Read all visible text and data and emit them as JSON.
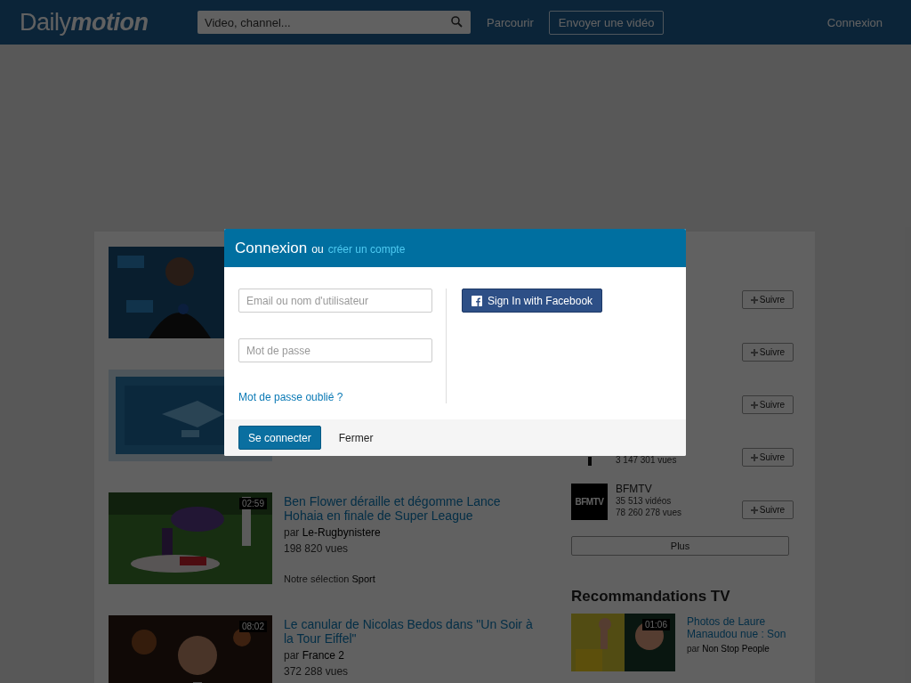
{
  "header": {
    "logo": "Daily**motion**",
    "search": {
      "placeholder": "Video, channel..."
    },
    "nav": [
      {
        "label": "Parcourir",
        "kind": "link"
      },
      {
        "label": "Envoyer une vidéo",
        "kind": "button"
      }
    ],
    "login": "Connexion"
  },
  "videos": [
    {
      "thumbnail": {
        "kind": "picture"
      }
    },
    {
      "thumbnail": {
        "kind": "picture"
      }
    },
    {
      "thumbnail": {
        "kind": "picture"
      },
      "duration": "02:59",
      "title": "Ben Flower déraille et dégomme Lance Hohaia en finale de Super League",
      "by_prefix": "par",
      "channel": "Le-Rugbynistere",
      "views": "198 820 vues",
      "selection_prefix": "Notre sélection",
      "selection": "Sport"
    },
    {
      "thumbnail": {
        "kind": "picture"
      },
      "duration": "08:02",
      "title": "Le canular de Nicolas Bedos dans \"Un Soir à la Tour Eiffel\"",
      "by_prefix": "par",
      "channel": "France 2",
      "views": "372 288 vues"
    }
  ],
  "channels": [
    {
      "kind": "plain",
      "follow": "Suivre"
    },
    {
      "kind": "plain",
      "follow": "Suivre"
    },
    {
      "kind": "plain",
      "follow": "Suivre"
    },
    {
      "kind": "mark",
      "views": "3 147 301 vues",
      "follow": "Suivre"
    },
    {
      "kind": "text",
      "logo": "BFMTV",
      "name": "BFMTV",
      "videos": "35 513 vidéos",
      "views": "78 260 278 vues",
      "follow": "Suivre"
    }
  ],
  "more_button": "Plus",
  "recommendations": {
    "title": "Recommandations TV",
    "items": [
      {
        "thumbnail": {
          "kind": "picture"
        },
        "duration": "01:06",
        "title": "Photos de Laure Manaudou nue : Son",
        "by_prefix": "par",
        "channel": "Non Stop People"
      }
    ]
  },
  "login_dialog": {
    "title": "Connexion",
    "or": "ou",
    "create_link": "créer un compte",
    "email": {
      "placeholder": "Email ou nom d'utilisateur"
    },
    "password": {
      "placeholder": "Mot de passe"
    },
    "forgot_link": "Mot de passe oublié ?",
    "facebook_button": "Sign In with Facebook",
    "submit_button": "Se connecter",
    "close_button": "Fermer"
  }
}
